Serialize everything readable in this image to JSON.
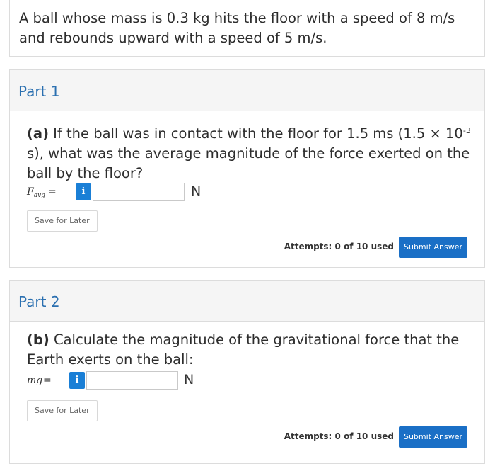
{
  "problem": {
    "text": "A ball whose mass is 0.3 kg hits the floor with a speed of 8 m/s and rebounds upward with a speed of 5 m/s."
  },
  "parts": [
    {
      "title": "Part 1",
      "question_prefix": "(a)",
      "question_before_exp": " If the ball was in contact with the floor for 1.5 ms (1.5 × 10",
      "exponent": "-3",
      "question_after_exp": " s), what was the average magnitude of the force exerted on the ball by the floor?",
      "variable": "F",
      "variable_sub": "avg",
      "equals": "=",
      "info_label": "i",
      "input_value": "",
      "unit": "N",
      "save_label": "Save for Later",
      "attempts": "Attempts: 0 of 10 used",
      "submit_label": "Submit Answer"
    },
    {
      "title": "Part 2",
      "question_prefix": "(b)",
      "question_text": " Calculate the magnitude of the gravitational force that the Earth exerts on the ball:",
      "variable": "mg",
      "equals": "=",
      "info_label": "i",
      "input_value": "",
      "unit": "N",
      "save_label": "Save for Later",
      "attempts": "Attempts: 0 of 10 used",
      "submit_label": "Submit Answer"
    }
  ],
  "colors": {
    "part_title": "#2a6fb0",
    "info_button": "#1a7fd6",
    "submit_button": "#1a6fc6"
  }
}
